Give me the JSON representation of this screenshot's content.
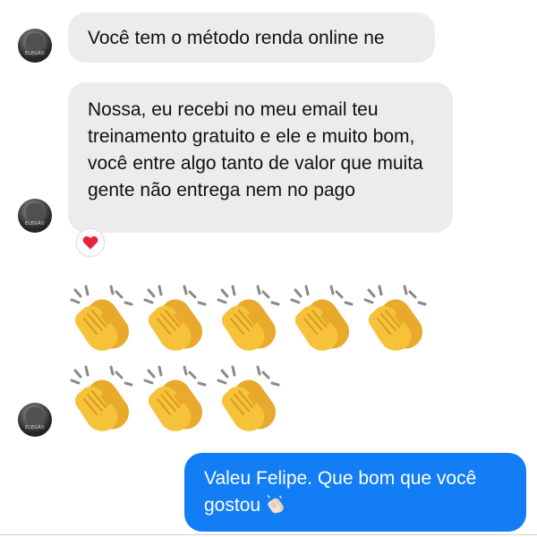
{
  "conversation": {
    "incoming": [
      {
        "text": "Você tem o método renda online ne"
      },
      {
        "text": "Nossa, eu recebi no meu email teu treinamento gratuito e ele e muito bom, você entre algo tanto de valor que muita gente não entrega nem no pago",
        "reaction": "❤️"
      }
    ],
    "clap_rows": [
      5,
      3
    ],
    "clap_emoji": "👏",
    "avatar_caption": "ELEGÃO",
    "outgoing": {
      "text": "Valeu Felipe. Que bom que você gostou",
      "emoji": "👏"
    }
  },
  "colors": {
    "incoming_bubble": "#ececec",
    "outgoing_bubble": "#127df5",
    "clap_yellow": "#f6c23a"
  }
}
